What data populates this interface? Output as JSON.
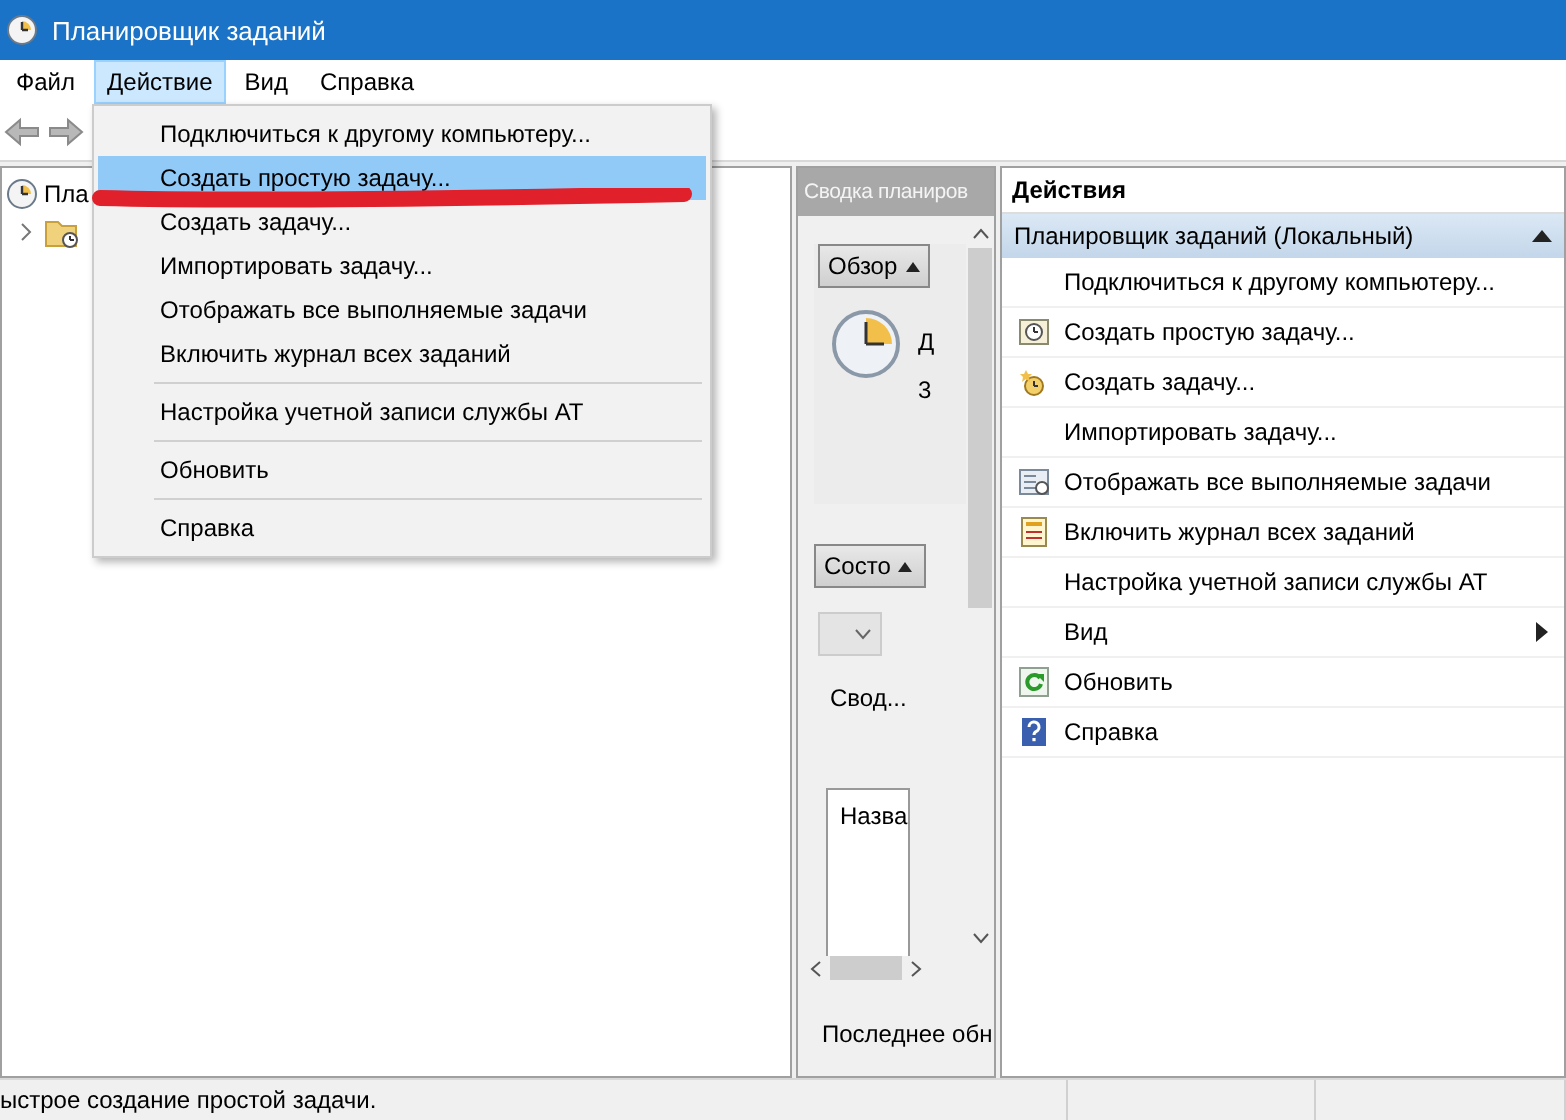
{
  "window": {
    "title": "Планировщик заданий"
  },
  "menu_bar": [
    {
      "label": "Файл",
      "selected": false
    },
    {
      "label": "Действие",
      "selected": true
    },
    {
      "label": "Вид",
      "selected": false
    },
    {
      "label": "Справка",
      "selected": false
    }
  ],
  "dropdown_menu": {
    "items": [
      {
        "label": "Подключиться к другому компьютеру...",
        "selected": false,
        "separator_before": false
      },
      {
        "label": "Создать простую задачу...",
        "selected": true,
        "separator_before": false
      },
      {
        "label": "Создать задачу...",
        "selected": false,
        "separator_before": false
      },
      {
        "label": "Импортировать задачу...",
        "selected": false,
        "separator_before": false
      },
      {
        "label": "Отображать все выполняемые задачи",
        "selected": false,
        "separator_before": false
      },
      {
        "label": "Включить журнал всех заданий",
        "selected": false,
        "separator_before": false
      },
      {
        "label": "Настройка учетной записи службы AT",
        "selected": false,
        "separator_before": true
      },
      {
        "label": "Обновить",
        "selected": false,
        "separator_before": true
      },
      {
        "label": "Справка",
        "selected": false,
        "separator_before": true
      }
    ]
  },
  "tree": [
    {
      "label": "Пла",
      "children": [
        {
          "expanded": false
        }
      ]
    }
  ],
  "summary_pane": {
    "title": "Сводка планиров",
    "overview_button": "Обзор",
    "overview_line_1": "Д",
    "overview_line_2": "3",
    "status_button": "Состо",
    "status_summary": "Свод...",
    "list_column": "Назва",
    "last_updated": "Последнее обн"
  },
  "actions_pane": {
    "title": "Действия",
    "section": {
      "label": "Планировщик заданий (Локальный)",
      "expanded": true
    },
    "items": [
      {
        "label": "Подключиться к другому компьютеру...",
        "kind": "plain"
      },
      {
        "label": "Создать простую задачу...",
        "kind": "wizard"
      },
      {
        "label": "Создать задачу...",
        "kind": "task"
      },
      {
        "label": "Импортировать задачу...",
        "kind": "plain"
      },
      {
        "label": "Отображать все выполняемые задачи",
        "kind": "running"
      },
      {
        "label": "Включить журнал всех заданий",
        "kind": "log"
      },
      {
        "label": "Настройка учетной записи службы AT",
        "kind": "plain"
      },
      {
        "label": "Вид",
        "kind": "submenu"
      },
      {
        "label": "Обновить",
        "kind": "refresh"
      },
      {
        "label": "Справка",
        "kind": "help"
      }
    ]
  },
  "status_bar": {
    "text": "ыстрое создание простой задачи."
  }
}
